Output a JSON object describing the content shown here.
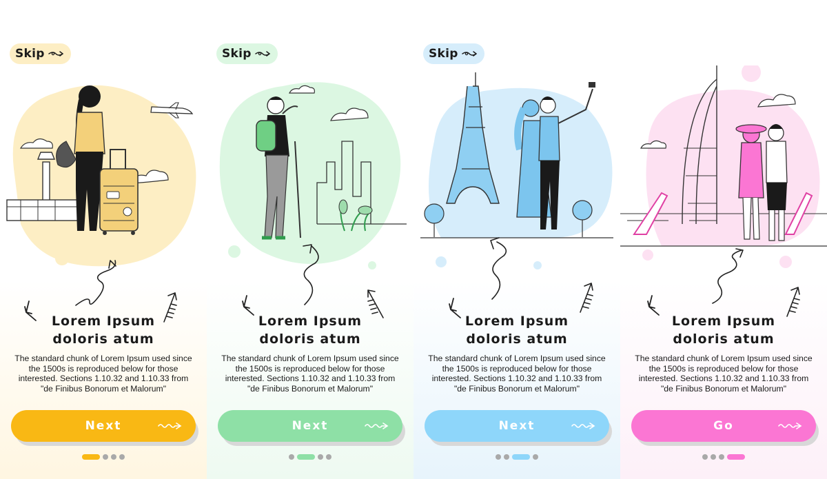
{
  "screens": [
    {
      "skip_label": "Skip",
      "title_line1": "Lorem Ipsum",
      "title_line2": "doloris atum",
      "description": "The standard chunk of Lorem Ipsum used since the 1500s is reproduced below for those interested. Sections 1.10.32 and 1.10.33 from \"de Finibus Bonorum et Malorum\"",
      "button_label": "Next",
      "active_dot": 0,
      "accent_color": "#f9b814",
      "blob_color": "#fdeec4",
      "bg_gradient_bottom": "#fff6e1",
      "illustration": "traveler-with-suitcase-airport"
    },
    {
      "skip_label": "Skip",
      "title_line1": "Lorem Ipsum",
      "title_line2": "doloris atum",
      "description": "The standard chunk of Lorem Ipsum used since the 1500s is reproduced below for those interested. Sections 1.10.32 and 1.10.33 from \"de Finibus Bonorum et Malorum\"",
      "button_label": "Next",
      "active_dot": 1,
      "accent_color": "#8ee0a6",
      "blob_color": "#dcf7e2",
      "bg_gradient_bottom": "#eefaf1",
      "illustration": "hiker-looking-at-city"
    },
    {
      "skip_label": "Skip",
      "title_line1": "Lorem Ipsum",
      "title_line2": "doloris atum",
      "description": "The standard chunk of Lorem Ipsum used since the 1500s is reproduced below for those interested. Sections 1.10.32 and 1.10.33 from \"de Finibus Bonorum et Malorum\"",
      "button_label": "Next",
      "active_dot": 2,
      "accent_color": "#8ed6fa",
      "blob_color": "#d6edfb",
      "bg_gradient_bottom": "#e7f4fc",
      "illustration": "couple-selfie-eiffel-tower"
    },
    {
      "skip_label": "Skip",
      "title_line1": "Lorem Ipsum",
      "title_line2": "doloris atum",
      "description": "The standard chunk of Lorem Ipsum used since the 1500s is reproduced below for those interested. Sections 1.10.32 and 1.10.33 from \"de Finibus Bonorum et Malorum\"",
      "button_label": "Go",
      "active_dot": 3,
      "accent_color": "#fb76d3",
      "blob_color": "#fde1f2",
      "bg_gradient_bottom": "#fdf0f8",
      "illustration": "couple-beach-burj-al-arab"
    }
  ],
  "dot_count": 4,
  "inactive_dot_color": "#a9a9a9"
}
